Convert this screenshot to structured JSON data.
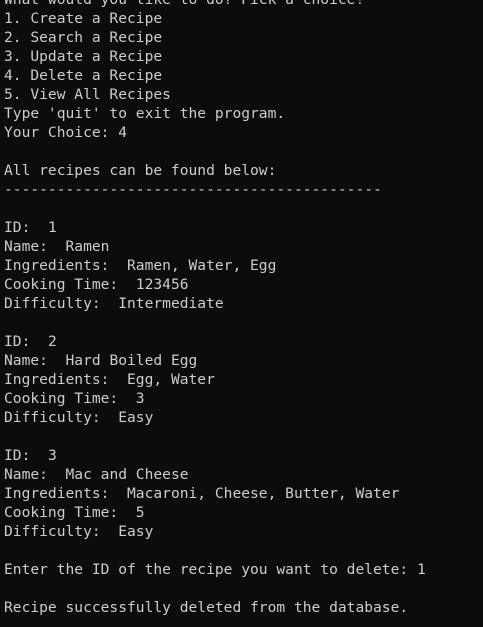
{
  "menu": {
    "prompt": "What would you like to do? Pick a choice!",
    "options": [
      "1. Create a Recipe",
      "2. Search a Recipe",
      "3. Update a Recipe",
      "4. Delete a Recipe",
      "5. View All Recipes"
    ],
    "quit_hint": "Type 'quit' to exit the program.",
    "choice_prompt": "Your Choice: ",
    "choice_value": "4"
  },
  "listing": {
    "header": "All recipes can be found below:",
    "divider": "-------------------------------------------"
  },
  "recipes": [
    {
      "id_label": "ID:  ",
      "id": "1",
      "name_label": "Name:  ",
      "name": "Ramen",
      "ingredients_label": "Ingredients:  ",
      "ingredients": "Ramen, Water, Egg",
      "time_label": "Cooking Time:  ",
      "time": "123456",
      "difficulty_label": "Difficulty:  ",
      "difficulty": "Intermediate"
    },
    {
      "id_label": "ID:  ",
      "id": "2",
      "name_label": "Name:  ",
      "name": "Hard Boiled Egg",
      "ingredients_label": "Ingredients:  ",
      "ingredients": "Egg, Water",
      "time_label": "Cooking Time:  ",
      "time": "3",
      "difficulty_label": "Difficulty:  ",
      "difficulty": "Easy"
    },
    {
      "id_label": "ID:  ",
      "id": "3",
      "name_label": "Name:  ",
      "name": "Mac and Cheese",
      "ingredients_label": "Ingredients:  ",
      "ingredients": "Macaroni, Cheese, Butter, Water",
      "time_label": "Cooking Time:  ",
      "time": "5",
      "difficulty_label": "Difficulty:  ",
      "difficulty": "Easy"
    }
  ],
  "delete": {
    "prompt": "Enter the ID of the recipe you want to delete: ",
    "value": "1",
    "result": "Recipe successfully deleted from the database."
  },
  "colors": {
    "background": "#0c0c0c",
    "text": "#cccccc"
  }
}
